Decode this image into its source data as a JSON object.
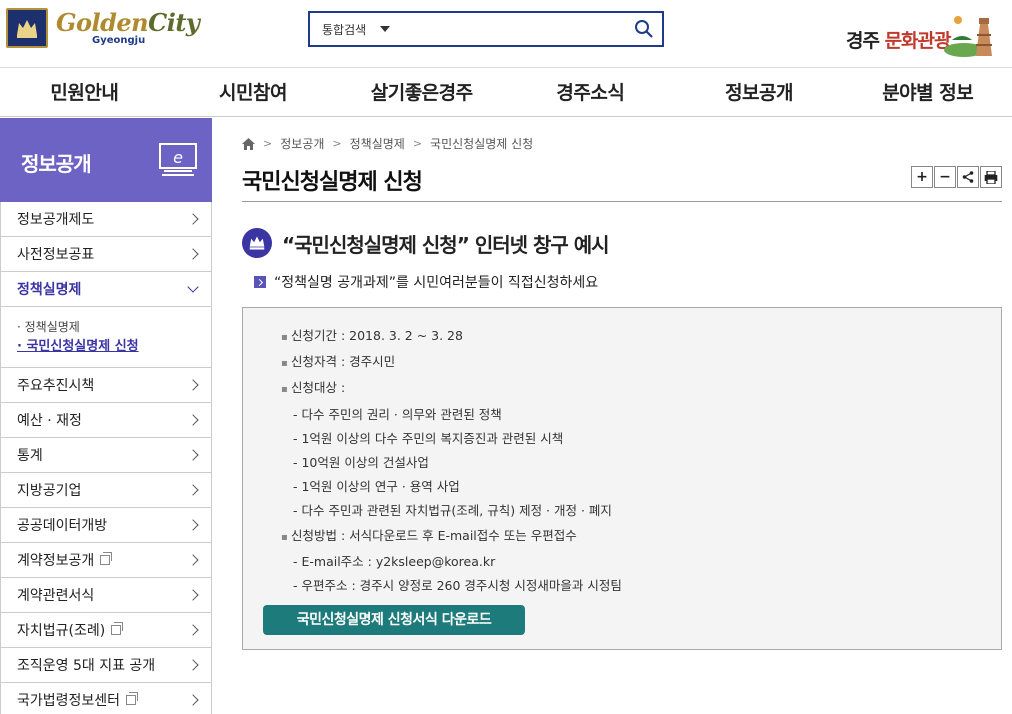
{
  "header": {
    "logo": {
      "golden": "Golden",
      "city": "City",
      "sub": "Gyeongju"
    },
    "search": {
      "scope": "통합검색",
      "placeholder": ""
    },
    "culture": {
      "prefix": "경주 ",
      "highlight": "문화관광"
    }
  },
  "gnb": [
    "민원안내",
    "시민참여",
    "살기좋은경주",
    "경주소식",
    "정보공개",
    "분야별 정보"
  ],
  "sidebar": {
    "title": "정보공개",
    "items": [
      {
        "label": "정보공개제도",
        "ext": false
      },
      {
        "label": "사전정보공표",
        "ext": false
      },
      {
        "label": "정책실명제",
        "ext": false,
        "active": true
      },
      {
        "label": "주요추진시책",
        "ext": false
      },
      {
        "label": "예산 · 재정",
        "ext": false
      },
      {
        "label": "통계",
        "ext": false
      },
      {
        "label": "지방공기업",
        "ext": false
      },
      {
        "label": "공공데이터개방",
        "ext": false
      },
      {
        "label": "계약정보공개",
        "ext": true
      },
      {
        "label": "계약관련서식",
        "ext": false
      },
      {
        "label": "자치법규(조례)",
        "ext": true
      },
      {
        "label": "조직운영 5대 지표 공개",
        "ext": false
      },
      {
        "label": "국가법령정보센터",
        "ext": true
      }
    ],
    "sub_items": [
      {
        "label": "정책실명제",
        "active": false
      },
      {
        "label": "국민신청실명제 신청",
        "active": true
      }
    ]
  },
  "breadcrumb": [
    "정보공개",
    "정책실명제",
    "국민신청실명제 신청"
  ],
  "page_title": "국민신청실명제 신청",
  "tools": {
    "plus": "+",
    "minus": "−"
  },
  "section": {
    "title": "“국민신청실명제 신청” 인터넷 창구 예시",
    "desc": "“정책실명 공개과제”를 시민여러분들이 직접신청하세요"
  },
  "info": [
    {
      "type": "b",
      "text": "신청기간 : 2018. 3. 2 ~ 3. 28"
    },
    {
      "type": "b",
      "text": "신청자격 : 경주시민"
    },
    {
      "type": "b",
      "text": "신청대상 :"
    },
    {
      "type": "d",
      "text": "다수 주민의 권리 · 의무와 관련된 정책"
    },
    {
      "type": "d",
      "text": "1억원 이상의 다수 주민의 복지증진과 관련된 시책"
    },
    {
      "type": "d",
      "text": "10억원 이상의 건설사업"
    },
    {
      "type": "d",
      "text": "1억원 이상의 연구 · 용역 사업"
    },
    {
      "type": "d",
      "text": "다수 주민과 관련된 자치법규(조례, 규칙) 제정 · 개정 · 폐지"
    },
    {
      "type": "b",
      "text": "신청방법 : 서식다운로드 후 E-mail접수 또는 우편접수"
    },
    {
      "type": "d",
      "text": "E-mail주소 : y2ksleep@korea.kr"
    },
    {
      "type": "d",
      "text": "우편주소 : 경주시 양정로 260 경주시청 시정새마을과 시정팀"
    }
  ],
  "download_label": "국민신청실명제 신청서식 다운로드",
  "colors": {
    "brand": "#6d63c4",
    "accent": "#3b35a4",
    "button": "#1e7b7b",
    "search_border": "#1e3a8a"
  }
}
